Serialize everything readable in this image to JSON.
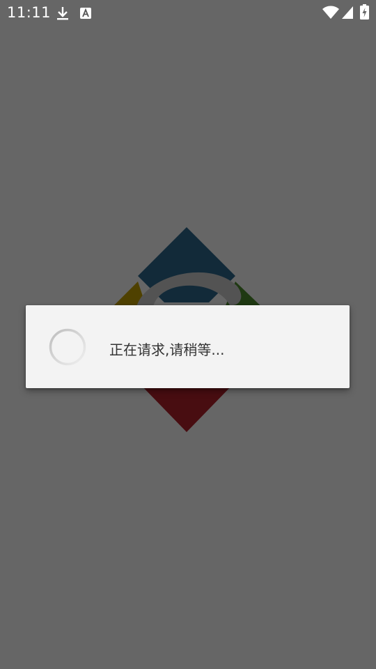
{
  "status_bar": {
    "time": "11:11",
    "left_icons": [
      "download-icon",
      "text-a-icon"
    ],
    "right_icons": [
      "wifi-icon",
      "signal-icon",
      "battery-charging-icon"
    ]
  },
  "splash": {
    "logo_icon": "app-logo-icon",
    "colors": {
      "blue": "#2f6a8f",
      "yellow": "#c5a400",
      "green": "#4e8e2e",
      "red": "#b3212c",
      "swirl": "#cfcfcf"
    }
  },
  "scrim_color": "#000000",
  "dialog": {
    "message": "正在请求,请稍等...",
    "spinner_icon": "loading-spinner-icon"
  }
}
